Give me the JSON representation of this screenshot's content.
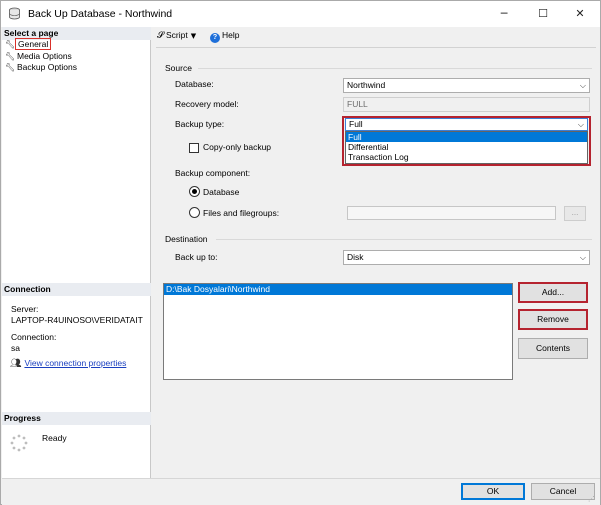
{
  "window": {
    "title": "Back Up Database - Northwind",
    "minimize_glyph": "─",
    "maximize_glyph": "☐",
    "close_glyph": "✕"
  },
  "left": {
    "select_page_header": "Select a page",
    "pages": [
      {
        "label": "General",
        "icon": "wrench-icon"
      },
      {
        "label": "Media Options",
        "icon": "wrench-icon"
      },
      {
        "label": "Backup Options",
        "icon": "wrench-icon"
      }
    ],
    "connection_header": "Connection",
    "server_label": "Server:",
    "server_value": "LAPTOP-R4UINOSO\\VERIDATAIT",
    "connection_label": "Connection:",
    "connection_value": "sa",
    "view_properties_link": "View connection properties",
    "progress_header": "Progress",
    "progress_status": "Ready"
  },
  "toolbar": {
    "script_label": "Script",
    "help_label": "Help"
  },
  "source": {
    "section_title": "Source",
    "database_label": "Database:",
    "database_value": "Northwind",
    "recovery_label": "Recovery model:",
    "recovery_value": "FULL",
    "backup_type_label": "Backup type:",
    "backup_type_value": "Full",
    "backup_type_options": [
      "Full",
      "Differential",
      "Transaction Log"
    ],
    "copy_only_label": "Copy-only backup",
    "component_label": "Backup component:",
    "component_database": "Database",
    "component_files": "Files and filegroups:",
    "browse_label": "..."
  },
  "destination": {
    "section_title": "Destination",
    "back_up_to_label": "Back up to:",
    "back_up_to_value": "Disk",
    "paths": [
      "D:\\Bak Dosyalari\\Northwind"
    ],
    "add_label": "Add...",
    "remove_label": "Remove",
    "contents_label": "Contents"
  },
  "footer": {
    "ok_label": "OK",
    "cancel_label": "Cancel"
  },
  "colors": {
    "accent_blue": "#0078d7",
    "highlight_red": "#b5232f"
  }
}
